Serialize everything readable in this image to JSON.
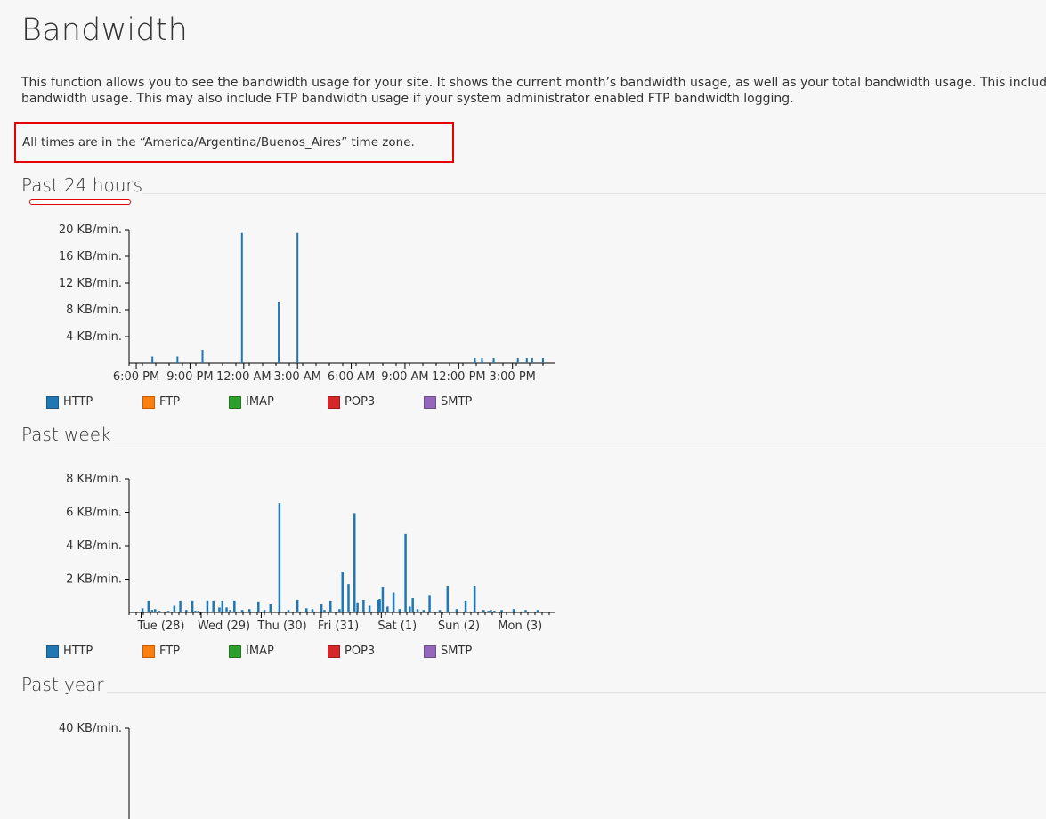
{
  "page": {
    "title": "Bandwidth",
    "description_line1": "This function allows you to see the bandwidth usage for your site. It shows the current month’s bandwidth usage, as well as your total bandwidth usage. This includes all HTTP",
    "description_line2": "bandwidth usage. This may also include FTP bandwidth usage if your system administrator enabled FTP bandwidth logging.",
    "timezone_note": "All times are in the “America/Argentina/Buenos_Aires” time zone."
  },
  "legend": [
    {
      "label": "HTTP",
      "color": "#1f77b4"
    },
    {
      "label": "FTP",
      "color": "#ff7f0e"
    },
    {
      "label": "IMAP",
      "color": "#2ca02c"
    },
    {
      "label": "POP3",
      "color": "#d62728"
    },
    {
      "label": "SMTP",
      "color": "#9467bd"
    }
  ],
  "sections": {
    "day": {
      "title": "Past 24 hours"
    },
    "week": {
      "title": "Past week"
    },
    "year": {
      "title": "Past year"
    }
  },
  "chart_data": [
    {
      "type": "bar",
      "title": "Past 24 hours",
      "yticks": [
        "20 KB/min.",
        "16 KB/min.",
        "12 KB/min.",
        "8 KB/min.",
        "4 KB/min."
      ],
      "ytick_values": [
        20,
        16,
        12,
        8,
        4
      ],
      "ylim": [
        0,
        20
      ],
      "xticks": [
        "6:00 PM",
        "9:00 PM",
        "12:00 AM",
        "3:00 AM",
        "6:00 AM",
        "9:00 AM",
        "12:00 PM",
        "3:00 PM"
      ],
      "x_range_hours": [
        -0.4,
        23.4
      ],
      "series": [
        {
          "name": "HTTP",
          "x": [
            0.9,
            2.3,
            3.7,
            5.9,
            7.95,
            9.0,
            18.9,
            19.3,
            19.95,
            21.3,
            21.8,
            22.1,
            22.7
          ],
          "values": [
            1.0,
            1.0,
            2.0,
            19.5,
            9.2,
            19.5,
            0.8,
            0.8,
            0.8,
            0.8,
            0.8,
            0.8,
            0.8
          ]
        }
      ]
    },
    {
      "type": "bar",
      "title": "Past week",
      "yticks": [
        "8 KB/min.",
        "6 KB/min.",
        "4 KB/min.",
        "2 KB/min."
      ],
      "ytick_values": [
        8,
        6,
        4,
        2
      ],
      "ylim": [
        0,
        8
      ],
      "xticks": [
        "Tue (28)",
        "Wed (29)",
        "Thu (30)",
        "Fri (31)",
        "Sat (1)",
        "Sun (2)",
        "Mon (3)"
      ],
      "x_range_days": [
        -0.2,
        6.9
      ],
      "series": [
        {
          "name": "HTTP",
          "x": [
            0.02,
            0.12,
            0.18,
            0.23,
            0.3,
            0.45,
            0.55,
            0.65,
            0.75,
            0.85,
            0.9,
            0.95,
            1.1,
            1.2,
            1.3,
            1.35,
            1.42,
            1.48,
            1.55,
            1.68,
            1.8,
            1.95,
            2.05,
            2.15,
            2.3,
            2.45,
            2.6,
            2.75,
            2.85,
            3.0,
            3.05,
            3.15,
            3.3,
            3.35,
            3.45,
            3.55,
            3.6,
            3.7,
            3.8,
            3.95,
            3.97,
            4.02,
            4.1,
            4.2,
            4.3,
            4.4,
            4.47,
            4.52,
            4.6,
            4.7,
            4.8,
            4.97,
            5.1,
            5.25,
            5.4,
            5.55,
            5.7,
            5.78,
            5.82,
            5.88,
            6.0,
            6.2,
            6.4,
            6.6
          ],
          "values": [
            0.25,
            0.7,
            0.15,
            0.2,
            0.1,
            0.1,
            0.4,
            0.7,
            0.15,
            0.7,
            0.1,
            0.1,
            0.7,
            0.7,
            0.3,
            0.7,
            0.3,
            0.15,
            0.7,
            0.15,
            0.2,
            0.65,
            0.15,
            0.5,
            6.55,
            0.15,
            0.75,
            0.25,
            0.2,
            0.5,
            0.15,
            0.7,
            0.2,
            2.45,
            1.7,
            5.95,
            0.6,
            0.75,
            0.4,
            0.75,
            0.8,
            1.55,
            0.35,
            1.2,
            0.2,
            4.7,
            0.35,
            0.85,
            0.2,
            0.15,
            1.05,
            0.15,
            1.6,
            0.2,
            0.7,
            1.6,
            0.15,
            0.1,
            0.15,
            0.1,
            0.15,
            0.2,
            0.15,
            0.15
          ]
        }
      ]
    },
    {
      "type": "bar",
      "title": "Past year",
      "yticks": [
        "40 KB/min."
      ],
      "ytick_values": [
        40
      ],
      "ylim": [
        0,
        40
      ],
      "xticks": [],
      "series": []
    }
  ]
}
